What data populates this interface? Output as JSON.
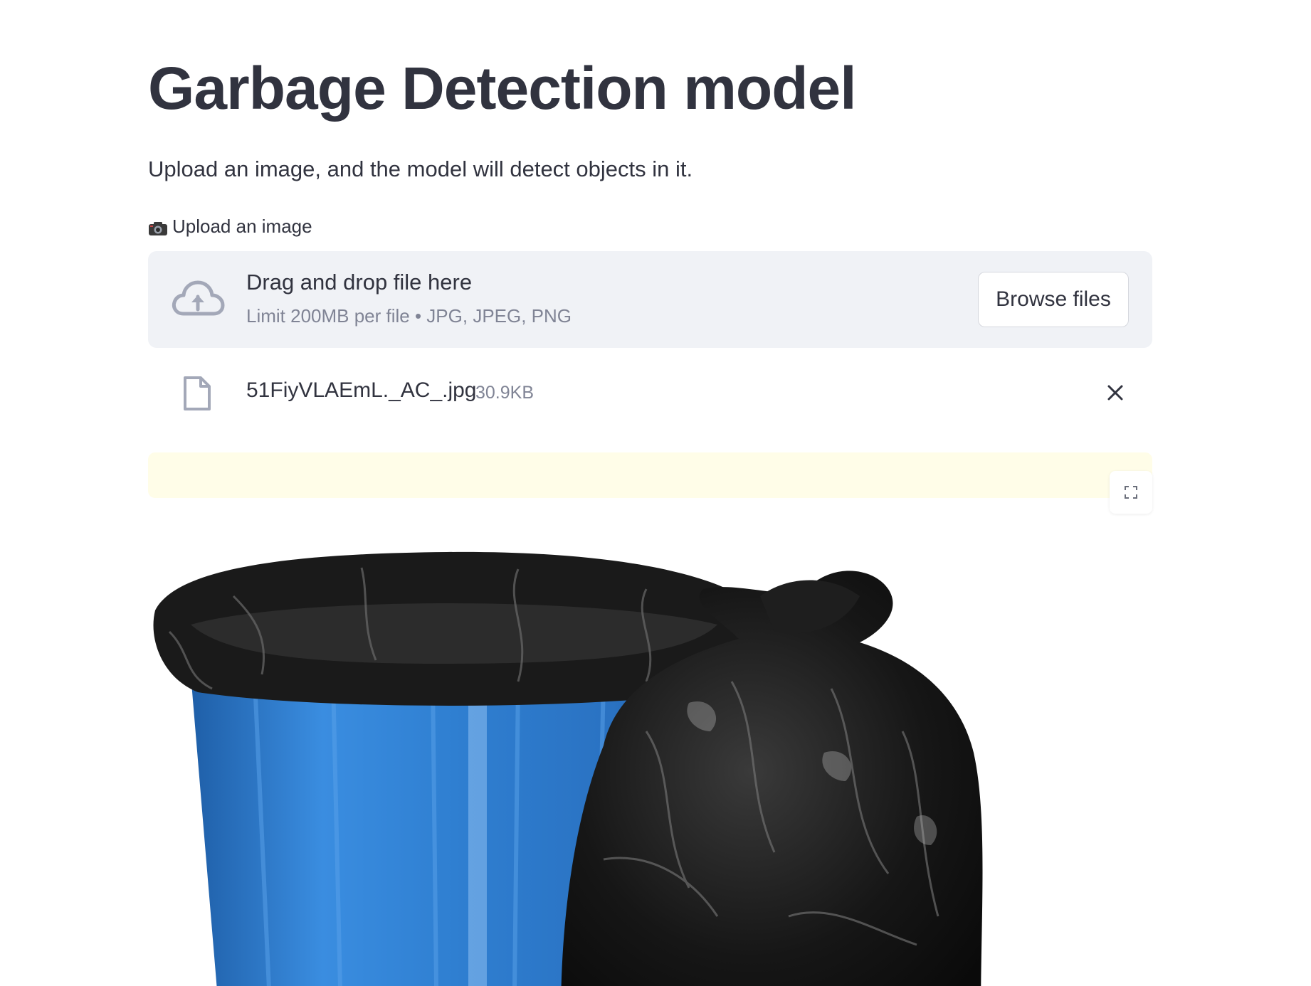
{
  "app": {
    "title": "Garbage Detection model",
    "subtitle": "Upload an image, and the model will detect objects in it."
  },
  "uploader": {
    "label": "Upload an image",
    "label_icon": "camera-icon",
    "dropzone_title": "Drag and drop file here",
    "dropzone_limit": "Limit 200MB per file • JPG, JPEG, PNG",
    "browse_label": "Browse files",
    "upload_icon": "cloud-upload-icon"
  },
  "uploaded_file": {
    "name": "51FiyVLAEmL._AC_.jpg",
    "size": "30.9KB",
    "icon": "file-icon",
    "remove_icon": "close-icon"
  },
  "status": {
    "color": "#fffde8"
  },
  "image_viewer": {
    "fullscreen_icon": "fullscreen-icon",
    "image_description_icon": "uploaded-image"
  },
  "colors": {
    "text": "#31333f",
    "muted": "#808495",
    "dropzone_bg": "#f0f2f6",
    "icon": "#a3a8b8",
    "bin_blue": "#2f7fd1",
    "bag_black": "#141414"
  }
}
